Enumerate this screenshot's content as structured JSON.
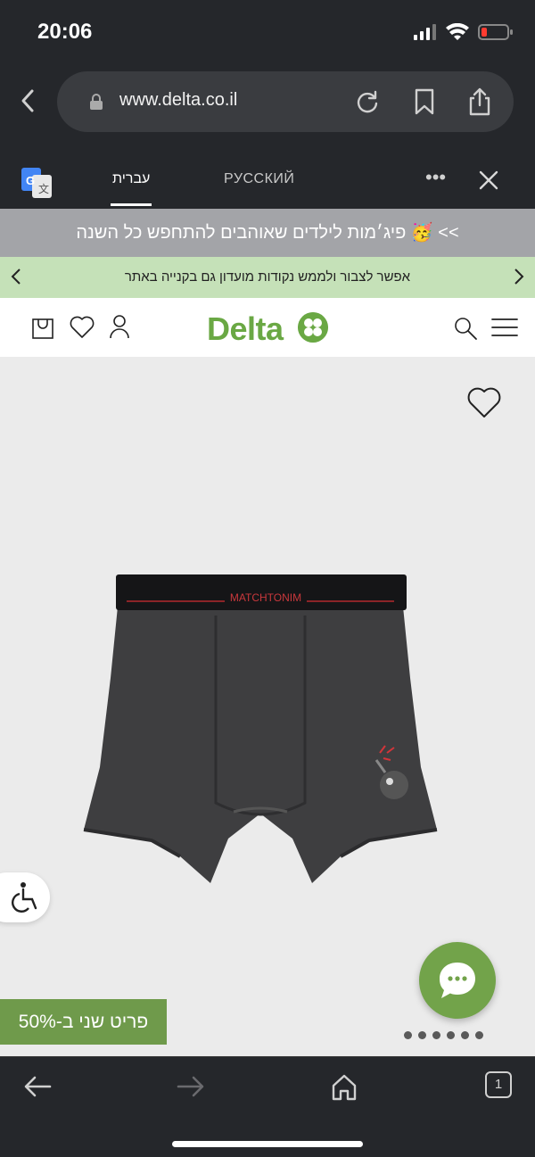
{
  "status": {
    "time": "20:06"
  },
  "browser": {
    "url": "www.delta.co.il",
    "translate": {
      "tab_hebrew": "עברית",
      "tab_russian": "РУССКИЙ",
      "more": "•••"
    }
  },
  "site": {
    "promo_text": "פיג׳מות לילדים שאוהבים להתחפש כל השנה 🥳 <<",
    "green_bar_text": "אפשר לצבור ולממש נקודות מועדון גם בקנייה באתר",
    "logo_text": "Delta",
    "brand_color": "#6aa844"
  },
  "product": {
    "waistband_text": "MATCHTONIM",
    "discount_badge": "פריט שני ב-50%",
    "carousel": {
      "total": 6,
      "active_index": 0
    }
  },
  "icons": {
    "status": [
      "signal-icon",
      "wifi-icon",
      "battery-icon"
    ],
    "browser": [
      "back-chevron-icon",
      "lock-icon",
      "reload-icon",
      "bookmark-icon",
      "share-icon"
    ],
    "header": [
      "cart-icon",
      "heart-icon",
      "user-icon",
      "search-icon",
      "menu-icon"
    ],
    "bottom": [
      "back-arrow-icon",
      "forward-arrow-icon",
      "home-icon",
      "tabs-icon"
    ]
  },
  "bottom_nav": {
    "tabs_count": "1"
  }
}
